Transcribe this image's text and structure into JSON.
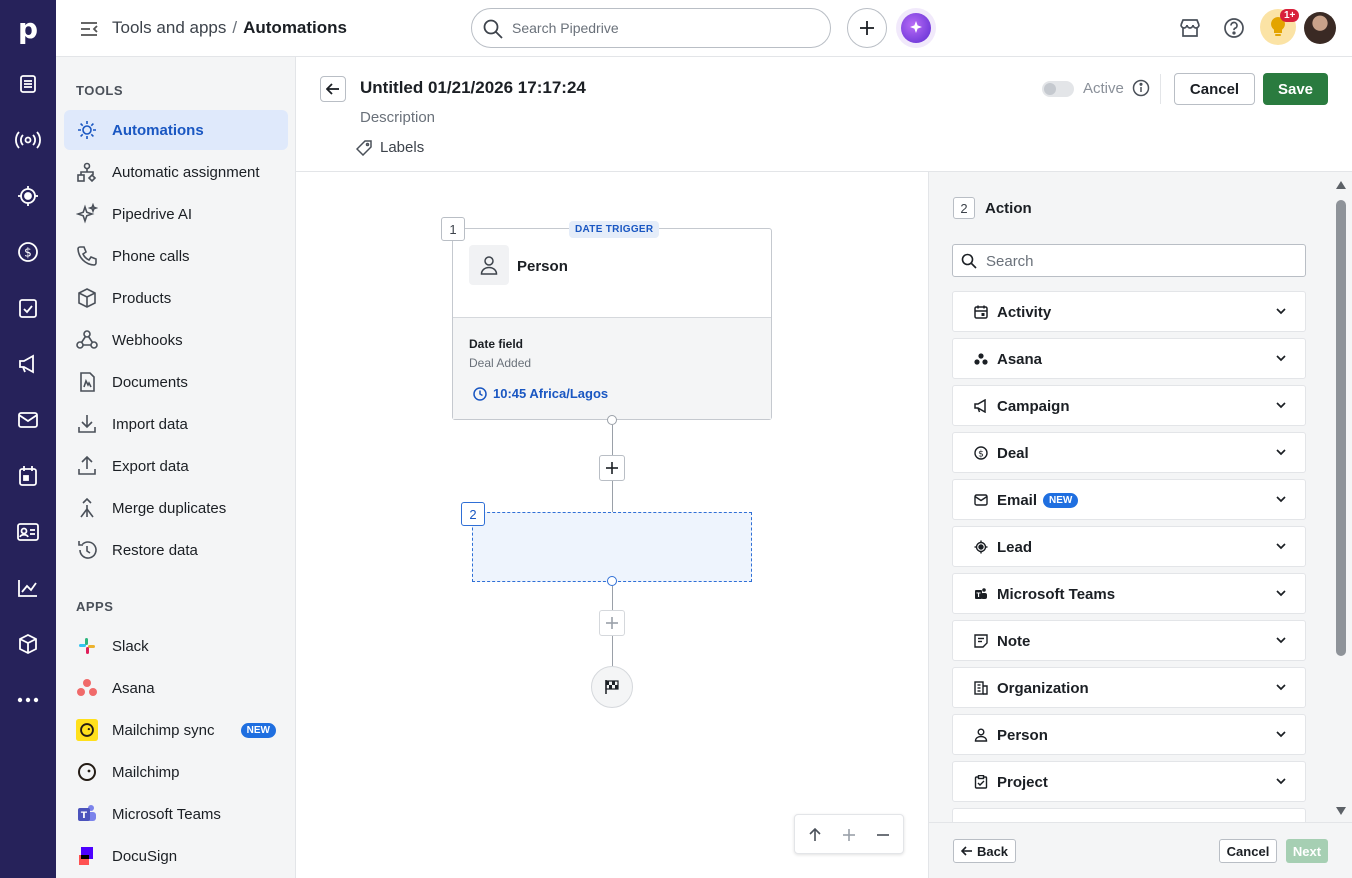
{
  "rail": {
    "logo": "p",
    "items": [
      "leads-icon",
      "radio-icon",
      "target-icon",
      "deals-icon",
      "tasks-icon",
      "campaigns-icon",
      "mail-icon",
      "calendar-icon",
      "contacts-icon",
      "insights-icon",
      "products-icon",
      "more-icon"
    ]
  },
  "topbar": {
    "breadcrumb_parent": "Tools and apps",
    "breadcrumb_sep": "/",
    "breadcrumb_current": "Automations",
    "search_placeholder": "Search Pipedrive",
    "notification_badge": "1+"
  },
  "sidebar": {
    "tools_heading": "TOOLS",
    "tools": [
      {
        "label": "Automations",
        "icon": "automations-icon",
        "active": true
      },
      {
        "label": "Automatic assignment",
        "icon": "assignment-icon"
      },
      {
        "label": "Pipedrive AI",
        "icon": "sparkle-icon"
      },
      {
        "label": "Phone calls",
        "icon": "phone-icon"
      },
      {
        "label": "Products",
        "icon": "box-icon"
      },
      {
        "label": "Webhooks",
        "icon": "webhook-icon"
      },
      {
        "label": "Documents",
        "icon": "document-icon"
      },
      {
        "label": "Import data",
        "icon": "import-icon"
      },
      {
        "label": "Export data",
        "icon": "export-icon"
      },
      {
        "label": "Merge duplicates",
        "icon": "merge-icon"
      },
      {
        "label": "Restore data",
        "icon": "restore-icon"
      }
    ],
    "apps_heading": "APPS",
    "apps": [
      {
        "label": "Slack",
        "icon": "slack-icon"
      },
      {
        "label": "Asana",
        "icon": "asana-icon"
      },
      {
        "label": "Mailchimp sync",
        "icon": "mailchimp-icon",
        "badge": "NEW"
      },
      {
        "label": "Mailchimp",
        "icon": "mailchimp-icon"
      },
      {
        "label": "Microsoft Teams",
        "icon": "teams-icon"
      },
      {
        "label": "DocuSign",
        "icon": "docusign-icon"
      }
    ]
  },
  "editor": {
    "title": "Untitled 01/21/2026 17:17:24",
    "description": "Description",
    "labels": "Labels",
    "active_label": "Active",
    "active": false,
    "cancel": "Cancel",
    "save": "Save"
  },
  "canvas": {
    "step1_num": "1",
    "trigger_badge": "DATE TRIGGER",
    "entity": "Person",
    "date_field_label": "Date field",
    "date_field_value": "Deal Added",
    "time": "10:45 Africa/Lagos",
    "step2_num": "2"
  },
  "panel": {
    "step_num": "2",
    "title": "Action",
    "search_placeholder": "Search",
    "items": [
      {
        "label": "Activity",
        "icon": "calendar-icon"
      },
      {
        "label": "Asana",
        "icon": "asana-icon"
      },
      {
        "label": "Campaign",
        "icon": "megaphone-icon"
      },
      {
        "label": "Deal",
        "icon": "dollar-icon"
      },
      {
        "label": "Email",
        "icon": "mail-icon",
        "badge": "NEW"
      },
      {
        "label": "Lead",
        "icon": "target-icon"
      },
      {
        "label": "Microsoft Teams",
        "icon": "teams-icon"
      },
      {
        "label": "Note",
        "icon": "note-icon"
      },
      {
        "label": "Organization",
        "icon": "building-icon"
      },
      {
        "label": "Person",
        "icon": "person-icon"
      },
      {
        "label": "Project",
        "icon": "project-icon"
      }
    ],
    "back": "Back",
    "cancel": "Cancel",
    "next": "Next"
  }
}
